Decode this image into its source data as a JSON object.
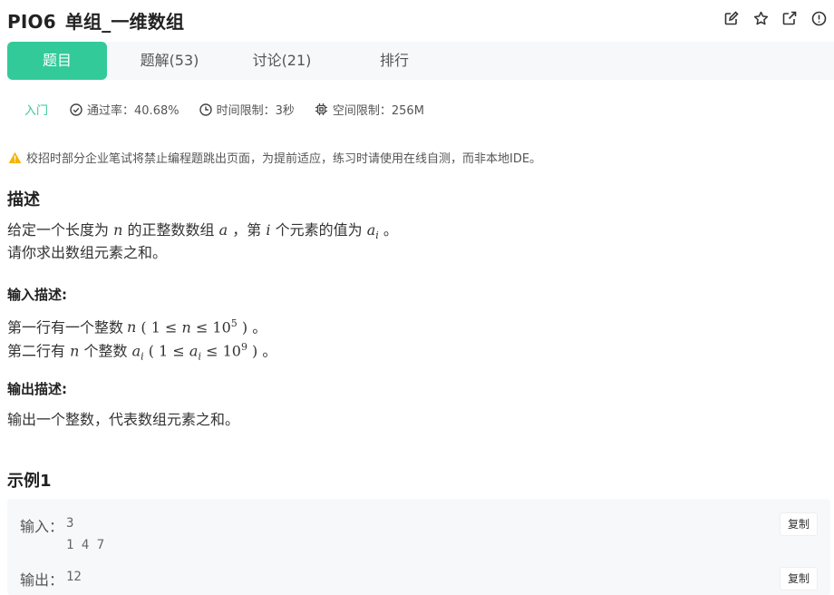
{
  "header": {
    "code": "PIO6",
    "name": "单组_一维数组",
    "icons": [
      "edit-icon",
      "star-icon",
      "share-icon",
      "report-icon"
    ]
  },
  "tabs": [
    {
      "label": "题目",
      "active": true
    },
    {
      "label": "题解(53)",
      "active": false
    },
    {
      "label": "讨论(21)",
      "active": false
    },
    {
      "label": "排行",
      "active": false
    }
  ],
  "meta": {
    "level": "入门",
    "pass_rate": "通过率：40.68%",
    "time_limit": "时间限制：3秒",
    "memory_limit": "空间限制：256M"
  },
  "notice": "校招时部分企业笔试将禁止编程题跳出页面，为提前适应，练习时请使用在线自测，而非本地IDE。",
  "description": {
    "heading": "描述",
    "line1_a": "给定一个长度为",
    "line1_n": "n",
    "line1_b": "的正整数数组",
    "line1_arr": "a",
    "line1_c": "，第",
    "line1_i": "i",
    "line1_d": "个元素的值为",
    "line1_ai": "a",
    "line1_ai_sub": "i",
    "line1_e": "。",
    "line2": "请你求出数组元素之和。"
  },
  "input_desc": {
    "heading": "输入描述:",
    "line1_a": "第一行有一个整数",
    "line1_var": "n",
    "line1_cond_open": "(",
    "line1_cond_1": "1 ≤",
    "line1_cond_n": "n",
    "line1_cond_le": "≤ 10",
    "line1_cond_exp": "5",
    "line1_cond_close": ")",
    "line1_end": "。",
    "line2_a": "第二行有",
    "line2_n": "n",
    "line2_b": "个整数",
    "line2_ai": "a",
    "line2_ai_sub": "i",
    "line2_cond_open": "(",
    "line2_cond_1": "1 ≤",
    "line2_cond_a": "a",
    "line2_cond_a_sub": "i",
    "line2_cond_le": "≤ 10",
    "line2_cond_exp": "9",
    "line2_cond_close": ")",
    "line2_end": "。"
  },
  "output_desc": {
    "heading": "输出描述:",
    "text": "输出一个整数，代表数组元素之和。"
  },
  "example": {
    "heading": "示例1",
    "input_label": "输入：",
    "input_line1": "3",
    "input_line2": "1 4 7",
    "output_label": "输出：",
    "output_value": "12",
    "copy_label": "复制"
  },
  "colors": {
    "accent": "#32ca99",
    "warning": "#f5b400",
    "tabbar_bg": "#f7f8fa"
  }
}
